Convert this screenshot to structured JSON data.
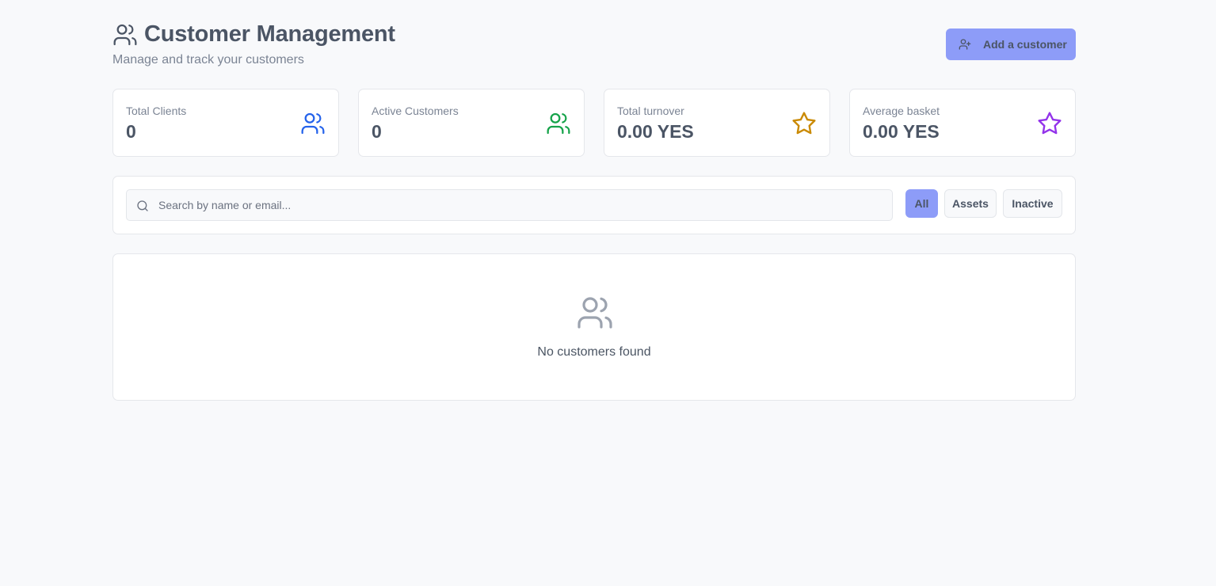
{
  "header": {
    "title": "Customer Management",
    "subtitle": "Manage and track your customers",
    "title_icon": "users-icon",
    "add_button": {
      "label": "Add a customer",
      "icon": "user-plus-icon"
    }
  },
  "stats": [
    {
      "label": "Total Clients",
      "value": "0",
      "icon": "users-icon",
      "color": "#2563eb"
    },
    {
      "label": "Active Customers",
      "value": "0",
      "icon": "users-icon",
      "color": "#16a34a"
    },
    {
      "label": "Total turnover",
      "value": "0.00 YES",
      "icon": "star-icon",
      "color": "#ca8a04"
    },
    {
      "label": "Average basket",
      "value": "0.00 YES",
      "icon": "star-icon",
      "color": "#9333ea"
    }
  ],
  "search": {
    "placeholder": "Search by name or email...",
    "value": ""
  },
  "filters": {
    "all": "All",
    "assets": "Assets",
    "inactive": "Inactive",
    "active_filter": "All"
  },
  "empty_state": {
    "icon": "users-icon",
    "message": "No customers found"
  },
  "colors": {
    "accent": "#8d9cf8",
    "background": "#f8f9fb"
  }
}
